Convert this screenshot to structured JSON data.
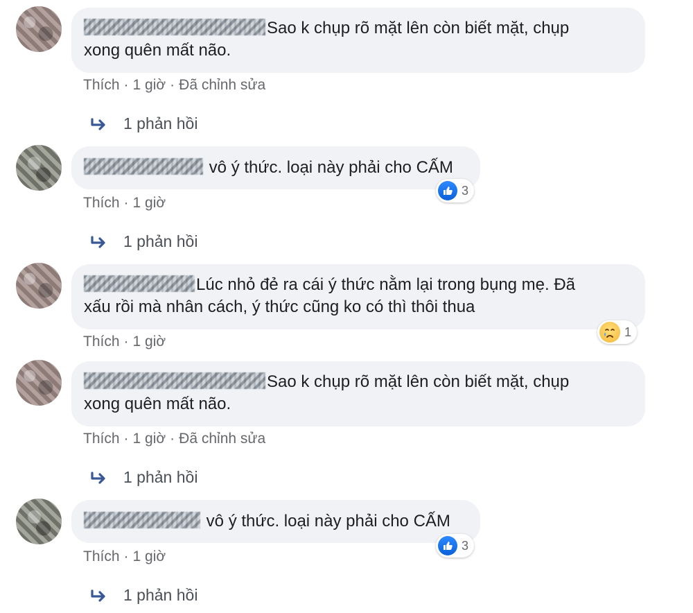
{
  "comments": [
    {
      "text": "Sao k chụp rõ mặt lên còn biết mặt, chụp xong quên mất não.",
      "line1": "Sao k chụp rõ mặt lên còn biết mặt, chụp",
      "line2": "xong quên mất não.",
      "like_label": "Thích",
      "time": "1 giờ",
      "edited": "Đã chỉnh sửa",
      "replies": "1 phản hồi"
    },
    {
      "text": "vô ý thức. loại này phải cho CẤM",
      "like_label": "Thích",
      "time": "1 giờ",
      "reaction": {
        "icon": "like-icon",
        "count": "3"
      },
      "replies": "1 phản hồi"
    },
    {
      "text": "Lúc nhỏ đẻ ra cái ý thức nằm lại trong bụng mẹ. Đã xấu rồi mà nhân cách, ý thức cũng ko có thì thôi thua",
      "line1": "Lúc nhỏ đẻ ra cái ý thức nằm lại trong bụng mẹ. Đã",
      "line2": "xấu rồi mà nhân cách, ý thức cũng ko có thì thôi thua",
      "like_label": "Thích",
      "time": "1 giờ",
      "reaction": {
        "icon": "sad-icon",
        "count": "1"
      }
    },
    {
      "text": "Sao k chụp rõ mặt lên còn biết mặt, chụp xong quên mất não.",
      "line1": "Sao k chụp rõ mặt lên còn biết mặt, chụp",
      "line2": "xong quên mất não.",
      "like_label": "Thích",
      "time": "1 giờ",
      "edited": "Đã chỉnh sửa",
      "replies": "1 phản hồi"
    },
    {
      "text": "vô ý thức. loại này phải cho CẤM",
      "like_label": "Thích",
      "time": "1 giờ",
      "reaction": {
        "icon": "like-icon",
        "count": "3"
      },
      "replies": "1 phản hồi"
    }
  ],
  "separator": "·",
  "colors": {
    "bubble": "#f0f2f5",
    "meta": "#65676b",
    "like_blue": "#1877f2"
  }
}
